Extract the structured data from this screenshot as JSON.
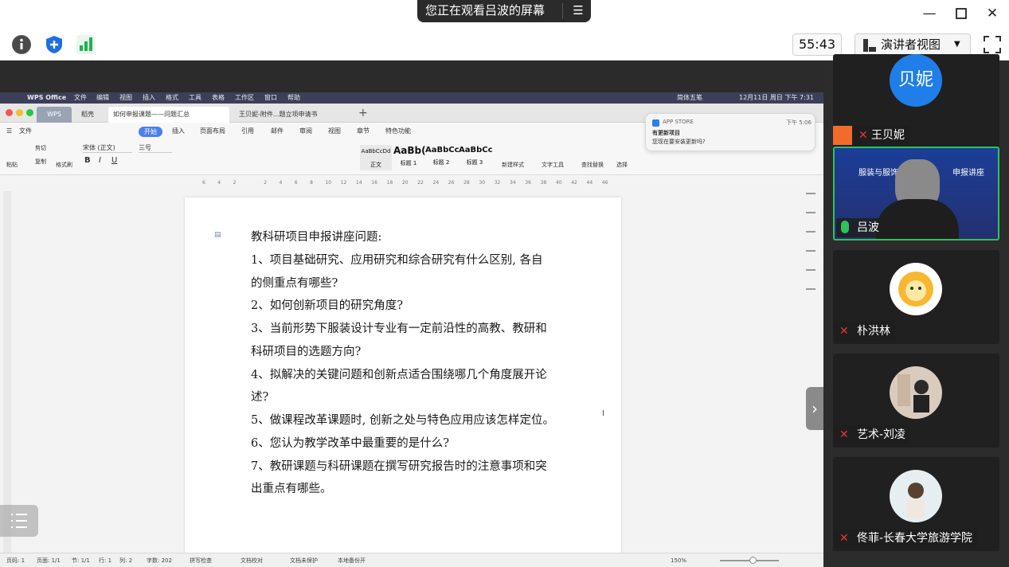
{
  "titlebar": {
    "share_status": "您正在观看吕波的屏幕",
    "share_menu_icon": "menu-icon"
  },
  "toolbar": {
    "timer": "55:43",
    "view_label": "演讲者视图"
  },
  "mac_menubar": {
    "app": "WPS Office",
    "items": [
      "文件",
      "编辑",
      "视图",
      "插入",
      "格式",
      "工具",
      "表格",
      "工作区",
      "窗口",
      "帮助"
    ],
    "right_text": "12月11日 周日 下午 7:31",
    "input_method": "简体五笔"
  },
  "wps": {
    "tabs": [
      "WPS",
      "稻壳",
      "如何申报课题——问题汇总",
      "王贝妮-附件...题立项申请书"
    ],
    "menu_items": [
      "文件",
      "开始",
      "插入",
      "页面布局",
      "引用",
      "邮件",
      "审阅",
      "视图",
      "章节",
      "特色功能"
    ],
    "active_menu": "开始",
    "ribbon": {
      "cut": "剪切",
      "copy": "复制",
      "paste": "粘贴",
      "format_painter": "格式刷",
      "font_name": "宋体 (正文)",
      "font_size": "三号",
      "styles": [
        {
          "sample": "AaBbCcDd",
          "name": "正文"
        },
        {
          "sample": "AaBb(",
          "name": "标题 1"
        },
        {
          "sample": "AaBbCc",
          "name": "标题 2"
        },
        {
          "sample": "AaBbCc",
          "name": "标题 3"
        }
      ],
      "new_style": "新建样式",
      "text_tools": "文字工具",
      "find_replace": "查找替换",
      "select": "选择"
    },
    "ruler_ticks": [
      "6",
      "4",
      "2",
      "",
      "2",
      "4",
      "6",
      "8",
      "10",
      "12",
      "14",
      "16",
      "18",
      "20",
      "22",
      "24",
      "26",
      "28",
      "30",
      "32",
      "34",
      "36",
      "38",
      "40",
      "42",
      "44",
      "46"
    ],
    "notification": {
      "source": "APP STORE",
      "time": "下午 5:06",
      "title": "有更新项目",
      "body": "您现在要安装更新吗?"
    },
    "document": {
      "lines": [
        "教科研项目申报讲座问题:",
        "1、项目基础研究、应用研究和综合研究有什么区别, 各自",
        "的侧重点有哪些?",
        "2、如何创新项目的研究角度?",
        "3、当前形势下服装设计专业有一定前沿性的高教、教研和",
        "科研项目的选题方向?",
        "4、拟解决的关键问题和创新点适合围绕哪几个角度展开论",
        "述?",
        "5、做课程改革课题时, 创新之处与特色应用应该怎样定位。",
        "6、您认为教学改革中最重要的是什么?",
        "7、教研课题与科研课题在撰写研究报告时的注意事项和突",
        "出重点有哪些。"
      ]
    },
    "statusbar": {
      "page_code": "页码: 1",
      "page": "页面: 1/1",
      "section": "节: 1/1",
      "row": "行: 1",
      "col": "列: 2",
      "words": "字数: 202",
      "spell": "拼写检查",
      "proof": "文档校对",
      "protect": "文档未保护",
      "backup": "本地备份开",
      "zoom": "150%"
    }
  },
  "participants": [
    {
      "name": "王贝妮",
      "avatar_text": "贝妮",
      "mic": "muted"
    },
    {
      "name": "吕波",
      "banner": "服装与服饰",
      "banner2": "申报讲座",
      "mic": "active"
    },
    {
      "name": "朴洪林",
      "mic": "muted"
    },
    {
      "name": "艺术-刘凌",
      "mic": "muted"
    },
    {
      "name": "佟菲-长春大学旅游学院",
      "mic": "muted"
    }
  ],
  "colors": {
    "accent_green": "#2fc25b",
    "avatar_blue": "#1f7ee8",
    "wps_tab_active": "#ffffff",
    "mac_menubar": "#3d3f58"
  }
}
